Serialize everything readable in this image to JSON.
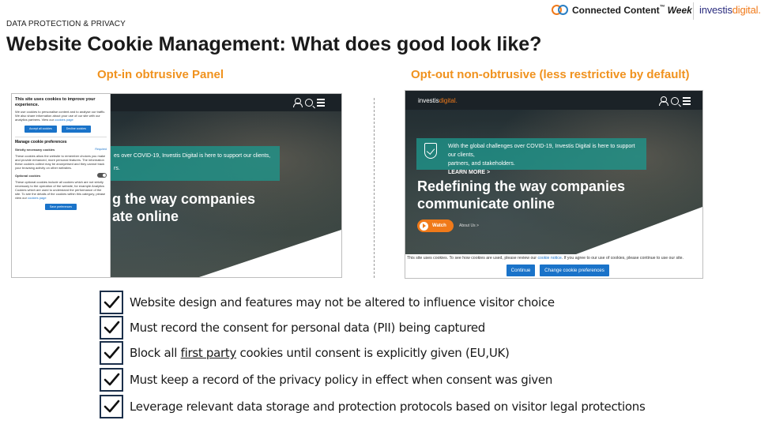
{
  "header": {
    "kicker": "DATA PROTECTION & PRIVACY",
    "title": "Website Cookie Management: What does good look like?",
    "brand_event": "Connected Content",
    "brand_event_tm": "™",
    "brand_event_week": "Week",
    "brand_company": "investis",
    "brand_company_accent": "digital."
  },
  "panels": {
    "left_title": "Opt-in obtrusive Panel",
    "right_title": "Opt-out non-obtrusive (less restrictive by default)"
  },
  "left_shot": {
    "panel_heading": "This site uses cookies to improve your experience.",
    "panel_intro": "We use cookies to personalise content and to analyse our traffic. We also share information about your use of our site with our analytics partners. View our",
    "panel_intro_link": "cookies page",
    "accept_label": "Accept all cookies",
    "decline_label": "Decline cookies",
    "manage_heading": "Manage cookie preferences",
    "strict_label": "Strictly necessary cookies",
    "strict_required": "Required",
    "strict_text": "These cookies allow the website to remember choices you make and provide enhanced, more personal features. The information these cookies collect may be anonymised and they cannot track your browsing activity on other websites.",
    "optional_label": "Optional cookies",
    "optional_text": "These optional cookies include all cookies which are not strictly necessary to the operation of the website, for example Analytics Cookies which are used to understand the performance of the site. To see the details of the cookies within this category, please view our",
    "optional_link": "cookies page",
    "save_label": "Save preferences",
    "band_text_1": "es over COVID-19, Investis Digital is here to support our clients,",
    "band_text_2": "rs.",
    "hero_line_1": "g the way companies",
    "hero_line_2": "ate online"
  },
  "right_shot": {
    "logo": "investis",
    "logo_accent": "digital.",
    "band_text_1": "With the global challenges over COVID-19, Investis Digital is here to support our clients,",
    "band_text_2": "partners, and stakeholders.",
    "band_link": "LEARN MORE >",
    "hero_line_1": "Redefining the way companies",
    "hero_line_2": "communicate online",
    "watch_label": "Watch",
    "about_label": "About Us >",
    "cookie_msg_1": "This site uses cookies. To see how cookies are used, please review our",
    "cookie_msg_link": "cookie notice",
    "cookie_msg_2": ". If you agree to our use of cookies, please continue to use our site.",
    "continue_label": "Continue",
    "change_label": "Change cookie preferences"
  },
  "checklist": [
    {
      "text": "Website design and features may not be altered to influence visitor choice"
    },
    {
      "text_before": "Block all ",
      "text_underlined": "first party",
      "text_after": " cookies until consent is explicitly given (EU,UK)"
    },
    {
      "text": "Must record the consent for personal data (PII) being captured"
    },
    {
      "text": "Must keep a record of the privacy policy in effect when consent was given"
    },
    {
      "text": "Leverage relevant data storage and protection protocols based on visitor legal protections"
    }
  ],
  "colors": {
    "orange": "#f0921e",
    "blue": "#1a73c9",
    "teal": "#1e968c",
    "navy": "#1b2f4a"
  }
}
